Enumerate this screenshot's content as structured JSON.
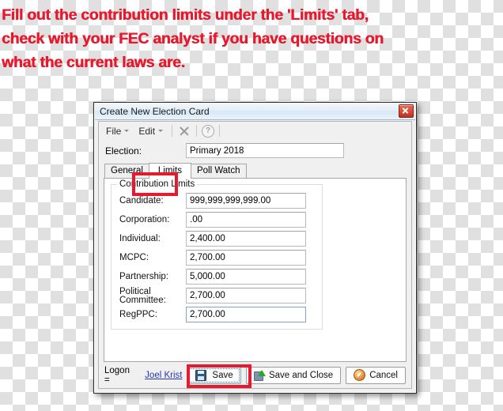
{
  "annotation": {
    "lines": [
      "Fill out the contribution limits under the 'Limits' tab,",
      "check with your FEC analyst if you have questions on",
      "what the current laws are."
    ],
    "color": "#e8192c",
    "highlight_boxes": [
      {
        "name": "limits-tab-highlight",
        "target": "Limits"
      },
      {
        "name": "save-button-highlight",
        "target": "Save"
      }
    ]
  },
  "dialog": {
    "title": "Create New Election Card",
    "close_button": "close-icon",
    "toolbar": {
      "menus": [
        {
          "label": "File",
          "caret": "chevron-down-icon"
        },
        {
          "label": "Edit",
          "caret": "chevron-down-icon"
        }
      ],
      "icons": [
        {
          "name": "delete-x-icon"
        },
        {
          "name": "help-icon",
          "glyph": "?"
        }
      ]
    },
    "election": {
      "label": "Election:",
      "value": "Primary 2018",
      "placeholder": ""
    },
    "tabs": [
      {
        "label": "General",
        "active": false
      },
      {
        "label": "Limits",
        "active": true
      },
      {
        "label": "Poll Watch",
        "active": false
      }
    ],
    "group": {
      "title": "Contribution Limits",
      "fields": [
        {
          "label": "Candidate:",
          "value": "999,999,999,999.00",
          "focused": false
        },
        {
          "label": "Corporation:",
          "value": ".00",
          "focused": false
        },
        {
          "label": "Individual:",
          "value": "2,400.00",
          "focused": false
        },
        {
          "label": "MCPC:",
          "value": "2,700.00",
          "focused": false
        },
        {
          "label": "Partnership:",
          "value": "5,000.00",
          "focused": false
        },
        {
          "label": "Political Committee:",
          "value": "2,700.00",
          "focused": false
        },
        {
          "label": "RegPPC:",
          "value": "2,700.00",
          "focused": true
        }
      ]
    },
    "footer": {
      "logon_label": "Logon =",
      "logon_user": "Joel Krist",
      "buttons": [
        {
          "label": "Save",
          "icon": "floppy-disk-icon"
        },
        {
          "label": "Save and Close",
          "icon": "floppy-disk-green-arrow-icon"
        },
        {
          "label": "Cancel",
          "icon": "cancel-circle-icon"
        }
      ]
    }
  }
}
